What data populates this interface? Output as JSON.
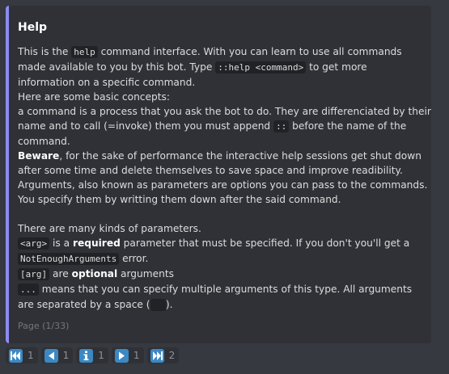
{
  "embed": {
    "title": "Help",
    "footer": "Page (1/33)",
    "accent_color": "#8b8cf0",
    "lines": [
      [
        {
          "t": "text",
          "v": "This is the "
        },
        {
          "t": "code",
          "v": "help"
        },
        {
          "t": "text",
          "v": " command interface. With you can learn to use all commands"
        }
      ],
      [
        {
          "t": "text",
          "v": "made available to you by this bot. Type "
        },
        {
          "t": "code",
          "v": "::help <command>"
        },
        {
          "t": "text",
          "v": " to get more"
        }
      ],
      [
        {
          "t": "text",
          "v": "information on a specific command."
        }
      ],
      [
        {
          "t": "text",
          "v": "Here are some basic concepts:"
        }
      ],
      [
        {
          "t": "text",
          "v": "a command is a process that you ask the bot to do. They are differenciated by their"
        }
      ],
      [
        {
          "t": "text",
          "v": "name and to call (=invoke) them you must append "
        },
        {
          "t": "code",
          "v": "::"
        },
        {
          "t": "text",
          "v": " before the name of the"
        }
      ],
      [
        {
          "t": "text",
          "v": "command."
        }
      ],
      [
        {
          "t": "bold",
          "v": "Beware"
        },
        {
          "t": "text",
          "v": ", for the sake of performance the interactive help sessions get shut down"
        }
      ],
      [
        {
          "t": "text",
          "v": "after some time and delete themselves to save space and improve readibility."
        }
      ],
      [
        {
          "t": "text",
          "v": "Arguments, also known as parameters are options you can pass to the commands."
        }
      ],
      [
        {
          "t": "text",
          "v": "You specify them by writting them down after the said command."
        }
      ],
      [],
      [
        {
          "t": "text",
          "v": "There are many kinds of parameters."
        }
      ],
      [
        {
          "t": "code",
          "v": "<arg>"
        },
        {
          "t": "text",
          "v": " is a "
        },
        {
          "t": "bold",
          "v": "required"
        },
        {
          "t": "text",
          "v": " parameter that must be specified. If you don't you'll get a"
        }
      ],
      [
        {
          "t": "code",
          "v": "NotEnoughArguments"
        },
        {
          "t": "text",
          "v": " error."
        }
      ],
      [
        {
          "t": "code",
          "v": "[arg]"
        },
        {
          "t": "text",
          "v": " are "
        },
        {
          "t": "bold",
          "v": "optional"
        },
        {
          "t": "text",
          "v": " arguments"
        }
      ],
      [
        {
          "t": "code",
          "v": "..."
        },
        {
          "t": "text",
          "v": " means that you can specify multiple arguments of this type. All arguments"
        }
      ],
      [
        {
          "t": "text",
          "v": "are separated by a space ("
        },
        {
          "t": "code",
          "v": "  "
        },
        {
          "t": "text",
          "v": ")."
        }
      ]
    ]
  },
  "reactions": [
    {
      "name": "first-page",
      "icon": "first-page-icon",
      "count": "1"
    },
    {
      "name": "previous-page",
      "icon": "previous-page-icon",
      "count": "1"
    },
    {
      "name": "info",
      "icon": "info-icon",
      "count": "1"
    },
    {
      "name": "next-page",
      "icon": "next-page-icon",
      "count": "1"
    },
    {
      "name": "last-page",
      "icon": "last-page-icon",
      "count": "2"
    }
  ],
  "colors": {
    "background": "#36393f",
    "embed_background": "#2f3136",
    "emoji_blue": "#3b88c3"
  }
}
